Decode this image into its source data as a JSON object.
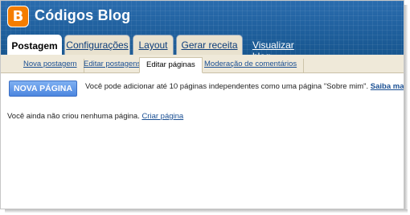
{
  "blog": {
    "title": "Códigos Blog",
    "logo_letter": "B",
    "logo_icon": "blogger-logo-icon"
  },
  "tabs": [
    {
      "label": "Postagem",
      "active": true
    },
    {
      "label": "Configurações",
      "active": false
    },
    {
      "label": "Layout",
      "active": false
    },
    {
      "label": "Gerar receita",
      "active": false
    }
  ],
  "view_blog_label": "Visualizar blog",
  "subtabs": [
    {
      "label": "Nova postagem",
      "active": false
    },
    {
      "label": "Editar postagens",
      "active": false
    },
    {
      "label": "Editar páginas",
      "active": true
    },
    {
      "label": "Moderação de comentários",
      "active": false
    }
  ],
  "main": {
    "new_page_button": "NOVA PÁGINA",
    "info_text": "Você pode adicionar até 10 páginas independentes como uma página \"Sobre mim\".",
    "learn_more": "Saiba mais",
    "empty_text": "Você ainda não criou nenhuma página.",
    "create_page": "Criar página"
  },
  "colors": {
    "header_blue": "#1c5f9d",
    "logo_orange": "#f57d00",
    "tab_beige": "#e9e2cf",
    "link_blue": "#1a4f93"
  }
}
